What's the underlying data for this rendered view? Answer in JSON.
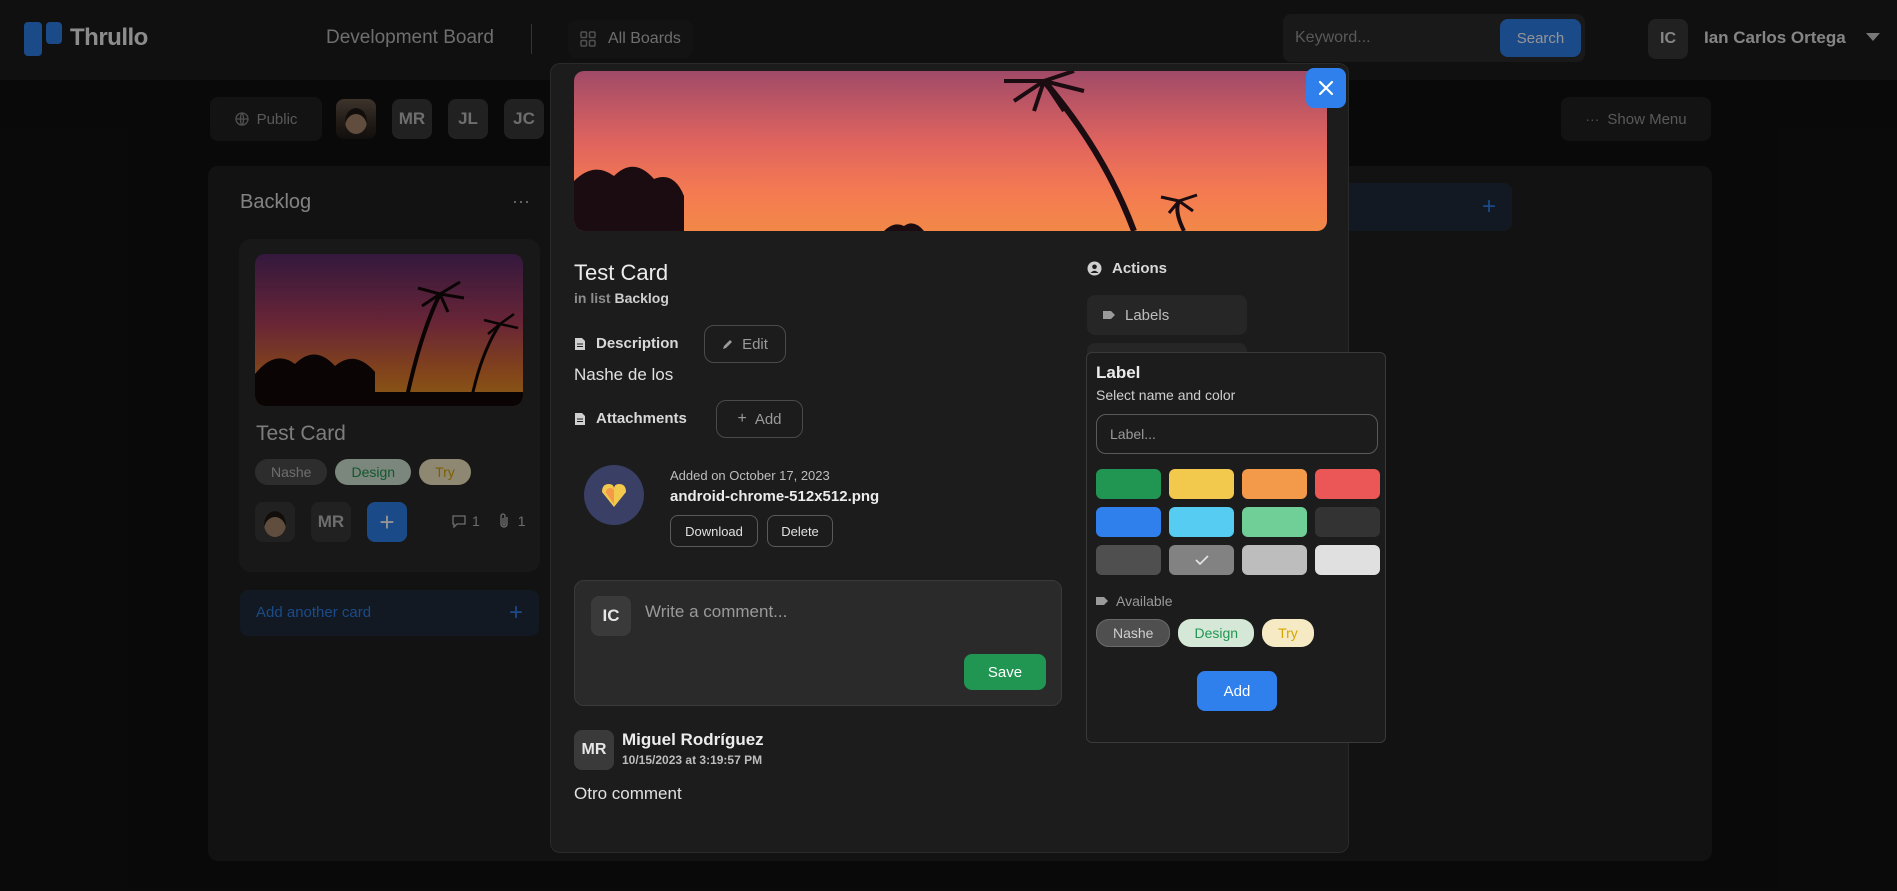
{
  "app": {
    "name": "Thrullo"
  },
  "topbar": {
    "board_title": "Development Board",
    "all_boards_label": "All Boards",
    "search_placeholder": "Keyword...",
    "search_button": "Search",
    "user_initials": "IC",
    "user_name": "Ian Carlos Ortega"
  },
  "board_header": {
    "visibility_label": "Public",
    "members": [
      "MR",
      "JL",
      "JC"
    ],
    "show_menu_label": "Show Menu"
  },
  "list": {
    "title": "Backlog",
    "menu_glyph": "···",
    "card": {
      "title": "Test Card",
      "labels": [
        {
          "name": "Nashe",
          "bg": "#4f4f4f",
          "fg": "#bdbdbd"
        },
        {
          "name": "Design",
          "bg": "#d5e8d8",
          "fg": "#219653"
        },
        {
          "name": "Try",
          "bg": "#f5eac4",
          "fg": "#d6a600"
        }
      ],
      "member_initials": "MR",
      "comments_count": "1",
      "attachments_count": "1"
    },
    "add_card_label": "Add another card"
  },
  "modal": {
    "title": "Test Card",
    "in_list_prefix": "in list",
    "in_list_name": "Backlog",
    "description_heading": "Description",
    "edit_label": "Edit",
    "description_text": "Nashe de los",
    "attachments_heading": "Attachments",
    "add_label": "Add",
    "attachment": {
      "added_on": "Added on October 17, 2023",
      "file_name": "android-chrome-512x512.png",
      "download_label": "Download",
      "delete_label": "Delete"
    },
    "comment_box": {
      "avatar_initials": "IC",
      "placeholder": "Write a comment...",
      "save_label": "Save"
    },
    "comment": {
      "avatar_initials": "MR",
      "author": "Miguel Rodríguez",
      "date": "10/15/2023 at 3:19:57 PM",
      "text": "Otro comment"
    },
    "actions_heading": "Actions",
    "labels_button": "Labels"
  },
  "label_popover": {
    "title": "Label",
    "subtitle": "Select name and color",
    "input_placeholder": "Label...",
    "colors": [
      {
        "hex": "#219653",
        "selected": false
      },
      {
        "hex": "#f2c94c",
        "selected": false
      },
      {
        "hex": "#f2994a",
        "selected": false
      },
      {
        "hex": "#eb5757",
        "selected": false
      },
      {
        "hex": "#2f80ed",
        "selected": false
      },
      {
        "hex": "#56ccf2",
        "selected": false
      },
      {
        "hex": "#6fcf97",
        "selected": false
      },
      {
        "hex": "#333333",
        "selected": false
      },
      {
        "hex": "#4f4f4f",
        "selected": false
      },
      {
        "hex": "#828282",
        "selected": true
      },
      {
        "hex": "#bdbdbd",
        "selected": false
      },
      {
        "hex": "#e0e0e0",
        "selected": false
      }
    ],
    "available_heading": "Available",
    "available_labels": [
      {
        "name": "Nashe",
        "bg": "#4f4f4f",
        "fg": "#d0d0d0"
      },
      {
        "name": "Design",
        "bg": "#d5e8d8",
        "fg": "#219653"
      },
      {
        "name": "Try",
        "bg": "#f5eac4",
        "fg": "#d6a600"
      }
    ],
    "add_label": "Add"
  },
  "icons": {
    "close": "close-icon",
    "description": "document-icon",
    "attachments": "document-icon",
    "edit": "pencil-icon",
    "add": "plus-icon",
    "actions": "user-circle-icon",
    "label": "tag-icon",
    "public": "globe-icon",
    "menu": "more-horizontal-icon",
    "boards": "grid-icon"
  }
}
